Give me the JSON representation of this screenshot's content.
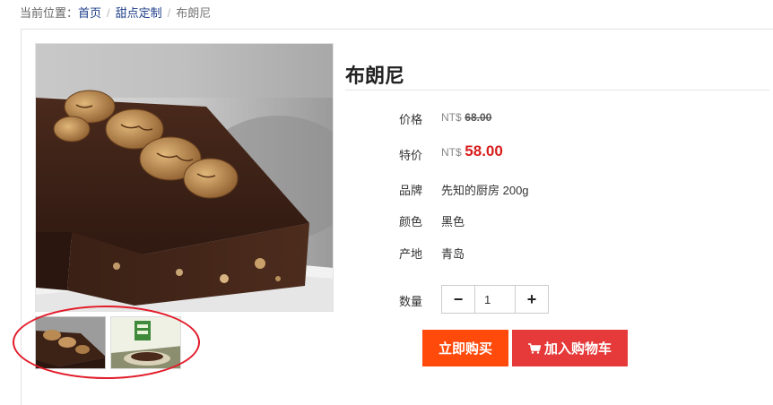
{
  "breadcrumb": {
    "prefix": "当前位置：",
    "home": "首页",
    "category": "甜点定制",
    "current": "布朗尼"
  },
  "product": {
    "title": "布朗尼",
    "price_label": "价格",
    "price_currency": "NT$",
    "price_value": "68.00",
    "special_label": "特价",
    "special_currency": "NT$",
    "special_value": "58.00",
    "brand_label": "品牌",
    "brand_value": "先知的厨房 200g",
    "color_label": "颜色",
    "color_value": "黑色",
    "origin_label": "产地",
    "origin_value": "青岛"
  },
  "quantity": {
    "label": "数量",
    "value": "1",
    "minus": "−",
    "plus": "+"
  },
  "actions": {
    "buy_now": "立即购买",
    "add_to_cart": "加入购物车"
  },
  "colors": {
    "buy_now_bg": "#ff4a0c",
    "add_to_cart_bg": "#e63a3a",
    "special_price": "#d71e1e",
    "link": "#1e3f8a",
    "annotation": "#e21b2a"
  },
  "icons": {
    "cart": "shopping-cart-icon"
  }
}
